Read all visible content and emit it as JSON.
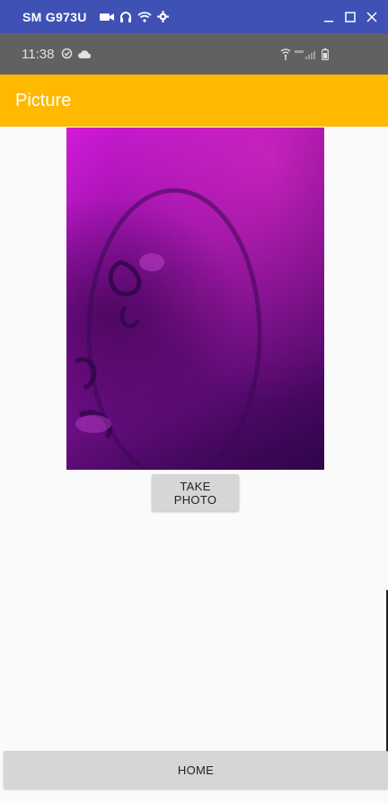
{
  "window": {
    "device_name": "SM G973U",
    "icons": [
      "video-camera-icon",
      "headphones-icon",
      "wifi-icon",
      "gear-icon"
    ],
    "controls": [
      "minimize-icon",
      "maximize-icon",
      "close-icon"
    ]
  },
  "status_bar": {
    "time": "11:38",
    "left_icons": [
      "sync-icon",
      "cloud-icon"
    ],
    "right_icons": [
      "wifi-icon",
      "lte-signal-icon",
      "battery-icon"
    ]
  },
  "app_bar": {
    "title": "Picture",
    "color": "#ffb900"
  },
  "photo": {
    "description_icon": "captured-photo-preview"
  },
  "buttons": {
    "take_photo": "TAKE PHOTO",
    "home": "HOME"
  }
}
